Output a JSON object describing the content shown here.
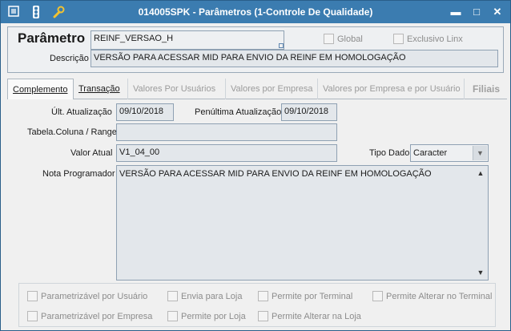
{
  "window": {
    "title": "014005SPK - Parâmetros (1-Controle De Qualidade)",
    "icons": [
      "menu-icon",
      "traffic-light-icon",
      "wrench-icon"
    ],
    "controls": {
      "minimize": "▬",
      "maximize": "□",
      "close": "✕"
    }
  },
  "parametro": {
    "label": "Parâmetro",
    "value": "REINF_VERSAO_H",
    "global_label": "Global",
    "exclusivo_label": "Exclusivo Linx",
    "descricao_label": "Descrição",
    "descricao_value": "VERSÃO PARA ACESSAR MID PARA ENVIO DA REINF EM HOMOLOGAÇÃO"
  },
  "tabs": [
    {
      "label": "Complemento",
      "active": true
    },
    {
      "label": "Transação",
      "active": false
    },
    {
      "label": "Valores Por Usuários",
      "active": false
    },
    {
      "label": "Valores por Empresa",
      "active": false
    },
    {
      "label": "Valores por Empresa e por Usuário",
      "active": false
    },
    {
      "label": "Filiais",
      "active": false
    }
  ],
  "complemento": {
    "ult_atualizacao_label": "Últ. Atualização",
    "ult_atualizacao_value": "09/10/2018",
    "penultima_label": "Penúltima Atualização",
    "penultima_value": "09/10/2018",
    "tabela_label": "Tabela.Coluna / Range",
    "tabela_value": "",
    "valor_atual_label": "Valor Atual",
    "valor_atual_value": "V1_04_00",
    "tipo_dado_label": "Tipo Dado",
    "tipo_dado_value": "Caracter",
    "nota_label": "Nota Programador",
    "nota_value": "VERSÃO PARA ACESSAR MID PARA ENVIO DA REINF EM HOMOLOGAÇÃO"
  },
  "flags": {
    "parametrizavel_usuario": "Parametrizável por Usuário",
    "envia_loja": "Envia para Loja",
    "permite_terminal": "Permite por Terminal",
    "permite_alterar_terminal": "Permite Alterar no Terminal",
    "parametrizavel_empresa": "Parametrizável por Empresa",
    "permite_loja": "Permite por Loja",
    "permite_alterar_loja": "Permite Alterar na Loja"
  }
}
